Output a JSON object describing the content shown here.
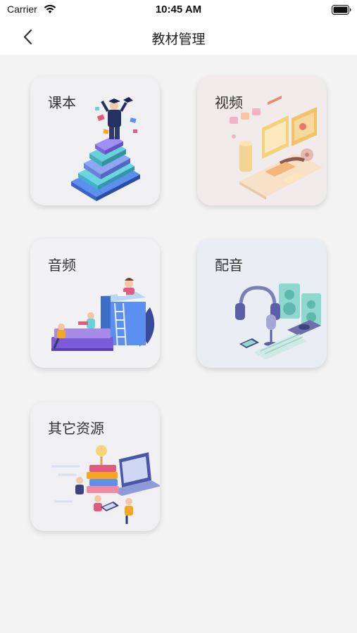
{
  "status_bar": {
    "carrier": "Carrier",
    "time": "10:45 AM"
  },
  "nav": {
    "title": "教材管理",
    "back_icon": "chevron-left-icon"
  },
  "cards": [
    {
      "label": "课本",
      "illustration": "graduate-on-books-illustration"
    },
    {
      "label": "视频",
      "illustration": "video-editing-illustration"
    },
    {
      "label": "音频",
      "illustration": "people-reading-books-illustration"
    },
    {
      "label": "配音",
      "illustration": "headphones-microphone-illustration"
    },
    {
      "label": "其它资源",
      "illustration": "laptop-resources-illustration"
    }
  ]
}
